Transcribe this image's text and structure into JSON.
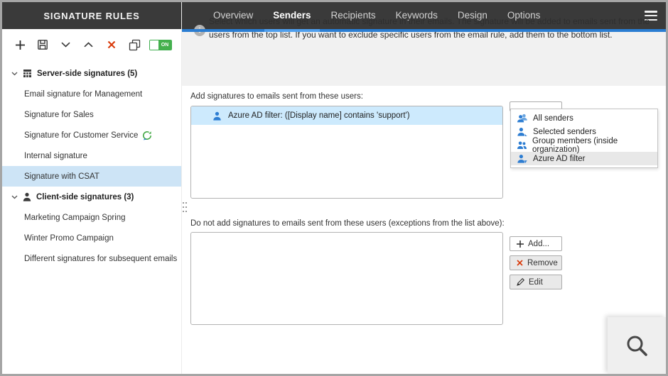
{
  "window": {
    "title": "SIGNATURE RULES"
  },
  "nav": {
    "tabs": [
      {
        "label": "Overview",
        "active": false
      },
      {
        "label": "Senders",
        "active": true
      },
      {
        "label": "Recipients",
        "active": false
      },
      {
        "label": "Keywords",
        "active": false
      },
      {
        "label": "Design",
        "active": false
      },
      {
        "label": "Options",
        "active": false
      }
    ],
    "menu_icon": "hamburger-icon"
  },
  "toolbar": {
    "icons": [
      "add-icon",
      "save-icon",
      "move-down-icon",
      "move-up-icon",
      "delete-icon",
      "duplicate-icon"
    ],
    "toggle": {
      "state": "on",
      "label": "ON"
    }
  },
  "sidebar": {
    "groups": [
      {
        "label": "Server-side signatures (5)",
        "icon": "server-signatures-icon",
        "expanded": true,
        "items": [
          {
            "label": "Email signature for Management"
          },
          {
            "label": "Signature for Sales"
          },
          {
            "label": "Signature for Customer Service",
            "badge_icon": "scheduler-icon"
          },
          {
            "label": "Internal signature"
          },
          {
            "label": "Signature with CSAT",
            "selected": true
          }
        ]
      },
      {
        "label": "Client-side signatures (3)",
        "icon": "client-signatures-icon",
        "expanded": true,
        "items": [
          {
            "label": "Marketing Campaign Spring"
          },
          {
            "label": "Winter Promo Campaign"
          },
          {
            "label": "Different signatures for subsequent emails"
          }
        ]
      }
    ]
  },
  "main": {
    "info_text": "Select which users will get an automatic signature in their emails. The signature will be added to emails sent from the users from the top list. If you want to exclude specific users from the email rule, add them to the bottom list.",
    "include_section": {
      "label": "Add signatures to emails sent from these users:",
      "items": [
        {
          "label": "Azure AD filter: ([Display name] contains 'support')",
          "icon": "user-icon",
          "selected": true
        }
      ]
    },
    "sender_type_menu": {
      "items": [
        {
          "label": "All senders",
          "icon": "all-senders-icon",
          "highlighted": false
        },
        {
          "label": "Selected senders",
          "icon": "selected-senders-icon",
          "highlighted": false
        },
        {
          "label": "Group members (inside organization)",
          "icon": "group-members-icon",
          "highlighted": false
        },
        {
          "label": "Azure AD filter",
          "icon": "azure-ad-filter-icon",
          "highlighted": true
        }
      ]
    },
    "exclude_section": {
      "label": "Do not add signatures to emails sent from these users (exceptions from the list above):",
      "items": [],
      "buttons": [
        {
          "label": "Add...",
          "icon": "add-icon"
        },
        {
          "label": "Remove",
          "icon": "remove-icon"
        },
        {
          "label": "Edit",
          "icon": "edit-icon"
        }
      ]
    },
    "zoom_button_icon": "magnifier-icon"
  },
  "colors": {
    "header_bg": "#3a3a3a",
    "accent_blue": "#2a7dd2",
    "active_tab_underline": "#4f9fee",
    "sidebar_selection": "#cde4f6",
    "list_selection": "#cdeafd",
    "toggle_green": "#44b04d",
    "danger_red": "#d93a0a",
    "icon_blue": "#2d7dd2",
    "info_band_bg": "#f1f1f1"
  }
}
